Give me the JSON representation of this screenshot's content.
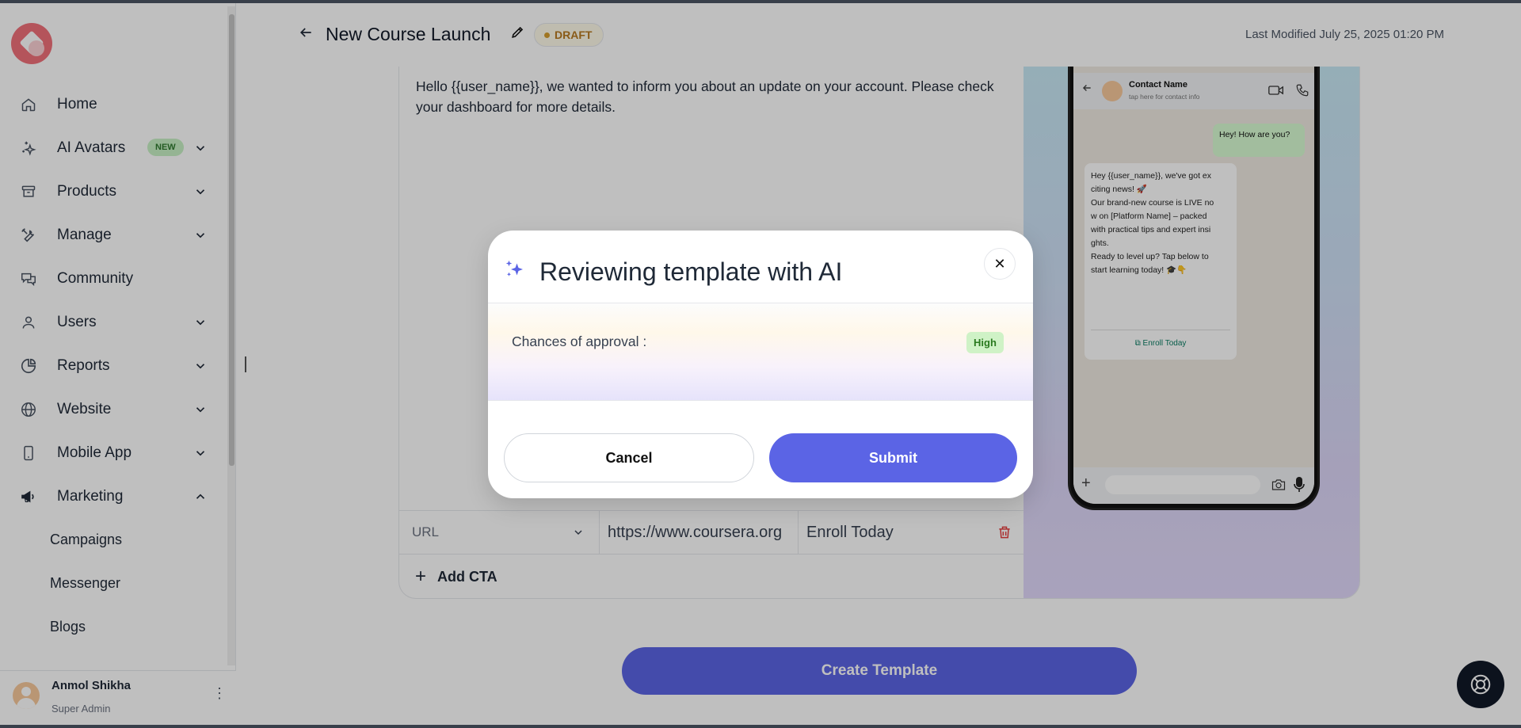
{
  "sidebar": {
    "items": [
      {
        "label": "Home",
        "icon": "home-icon"
      },
      {
        "label": "AI Avatars",
        "icon": "sparkles-icon",
        "badge": "NEW"
      },
      {
        "label": "Products",
        "icon": "archive-box-icon"
      },
      {
        "label": "Manage",
        "icon": "tools-icon"
      },
      {
        "label": "Community",
        "icon": "chat-bubbles-icon"
      },
      {
        "label": "Users",
        "icon": "user-icon"
      },
      {
        "label": "Reports",
        "icon": "pie-chart-icon"
      },
      {
        "label": "Website",
        "icon": "globe-icon"
      },
      {
        "label": "Mobile App",
        "icon": "mobile-icon"
      },
      {
        "label": "Marketing",
        "icon": "megaphone-icon"
      }
    ],
    "marketing_sub": [
      "Campaigns",
      "Messenger",
      "Blogs"
    ],
    "profile": {
      "name": "Anmol Shikha",
      "role": "Super Admin"
    }
  },
  "header": {
    "title": "New Course Launch",
    "status": "DRAFT",
    "last_modified": "Last Modified July 25, 2025 01:20 PM"
  },
  "editor": {
    "message": "Hello {{user_name}}, we wanted to inform you about an update on your account. Please check your dashboard for more details.",
    "cta": {
      "type": "URL",
      "url": "https://www.coursera.org",
      "label": "Enroll Today"
    },
    "add_cta": "Add CTA"
  },
  "preview": {
    "contact_name": "Contact Name",
    "contact_sub": "tap here for contact info",
    "outgoing": "Hey! How are you?",
    "incoming_lines": [
      "Hey {{user_name}}, we've got ex",
      "citing news! 🚀",
      "Our brand-new course is LIVE no",
      "w on [Platform Name] – packed",
      "with practical tips and expert insi",
      "ghts.",
      "Ready to level up? Tap below to",
      "start learning today! 🎓👇"
    ],
    "button": "Enroll Today"
  },
  "create_button": "Create Template",
  "modal": {
    "title": "Reviewing template with AI",
    "approval_label": "Chances of approval :",
    "approval_value": "High",
    "cancel": "Cancel",
    "submit": "Submit"
  },
  "colors": {
    "primary": "#5b64e5",
    "draft_text": "#b7791f",
    "high_bg": "#cff2c6",
    "new_badge_bg": "#c7f0c4"
  }
}
